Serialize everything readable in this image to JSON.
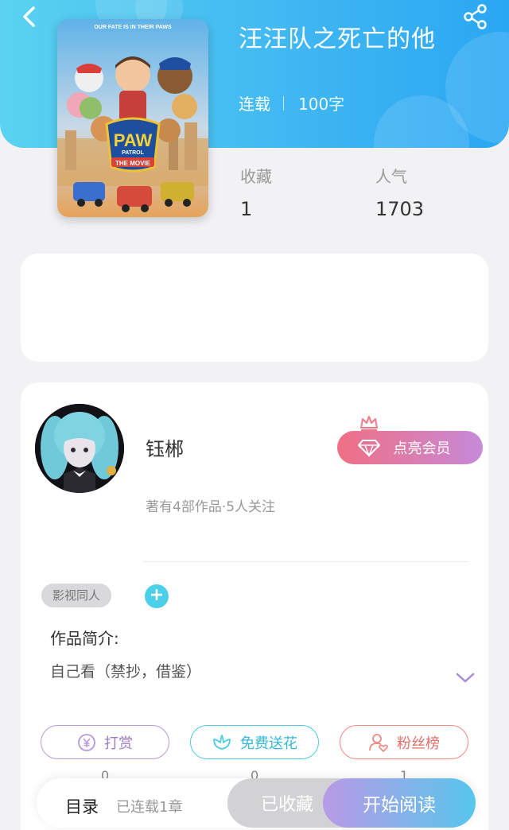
{
  "colors": {
    "header": "#3fb6f2",
    "accent": "#4ccfe9",
    "member_from": "#f06f84",
    "member_to": "#c68ad9",
    "read_from": "#b89ae6",
    "read_to": "#57c6ec"
  },
  "header": {
    "back_icon": "chevron-left-icon",
    "share_icon": "share-icon"
  },
  "book": {
    "title": "汪汪队之死亡的他",
    "status": "连载",
    "word_count": "100字",
    "cover": {
      "top_text": "OUR FATE IS IN THEIR PAWS",
      "logo": "PAW",
      "logo_sub": "PATROL",
      "movie_text": "THE MOVIE"
    },
    "stats": [
      {
        "label": "收藏",
        "value": "1"
      },
      {
        "label": "人气",
        "value": "1703"
      }
    ]
  },
  "author": {
    "name": "钰郴",
    "subtitle": "著有4部作品·5人关注",
    "member_button": "点亮会员"
  },
  "tags": [
    "影视同人"
  ],
  "tag_add": "+",
  "intro": {
    "title": "作品简介:",
    "text": "自己看（禁抄，借鉴）"
  },
  "actions": [
    {
      "label": "打赏",
      "icon": "yen-coin-icon",
      "count": "0"
    },
    {
      "label": "免费送花",
      "icon": "flower-icon",
      "count": "0"
    },
    {
      "label": "粉丝榜",
      "icon": "user-heart-icon",
      "count": "1"
    }
  ],
  "bottom_bar": {
    "toc_label": "目录",
    "toc_sub": "已连载1章",
    "collected": "已收藏",
    "read": "开始阅读"
  }
}
